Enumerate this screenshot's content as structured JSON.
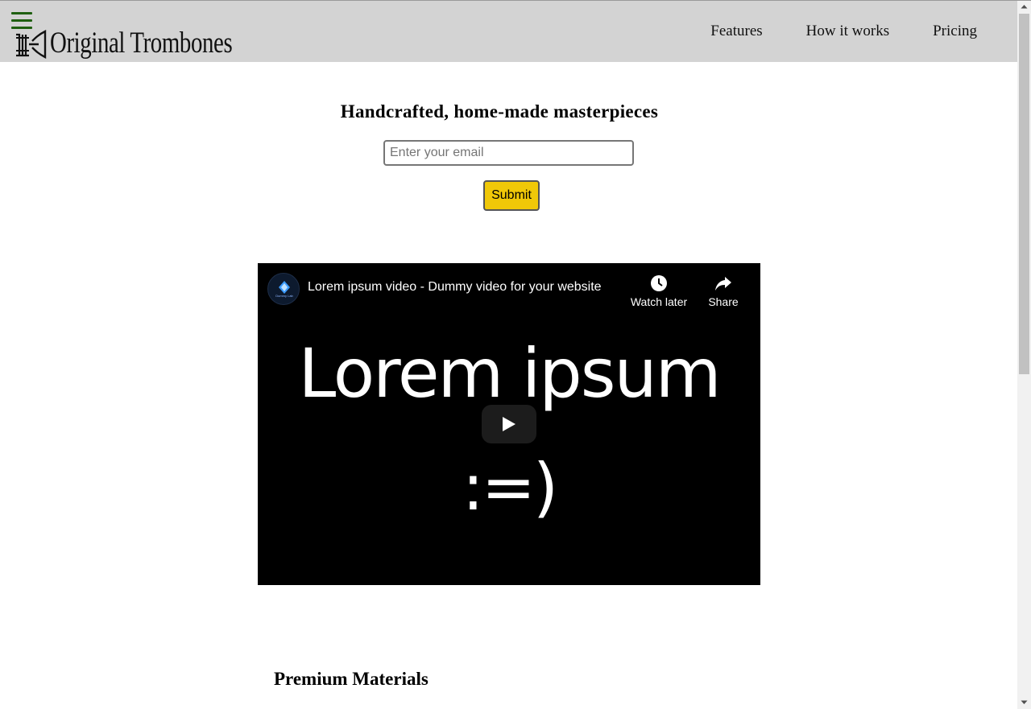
{
  "header": {
    "brand": "Original Trombones",
    "nav": [
      {
        "label": "Features"
      },
      {
        "label": "How it works"
      },
      {
        "label": "Pricing"
      }
    ]
  },
  "hero": {
    "title": "Handcrafted, home-made masterpieces",
    "email_placeholder": "Enter your email",
    "email_value": "",
    "submit_label": "Submit"
  },
  "video": {
    "title": "Lorem ipsum video - Dummy video for your website",
    "channel_badge": "Dummy Lab",
    "watch_later_label": "Watch later",
    "share_label": "Share",
    "frame_line1": "Lorem ipsum",
    "frame_line2": ":=)"
  },
  "section": {
    "title": "Premium Materials"
  },
  "colors": {
    "header_bg": "#d3d3d3",
    "hamburger": "#1f5f10",
    "submit_bg": "#f0c808"
  },
  "icons": [
    "hamburger-menu-icon",
    "trombone-logo-icon",
    "clock-icon",
    "share-arrow-icon",
    "play-icon"
  ]
}
